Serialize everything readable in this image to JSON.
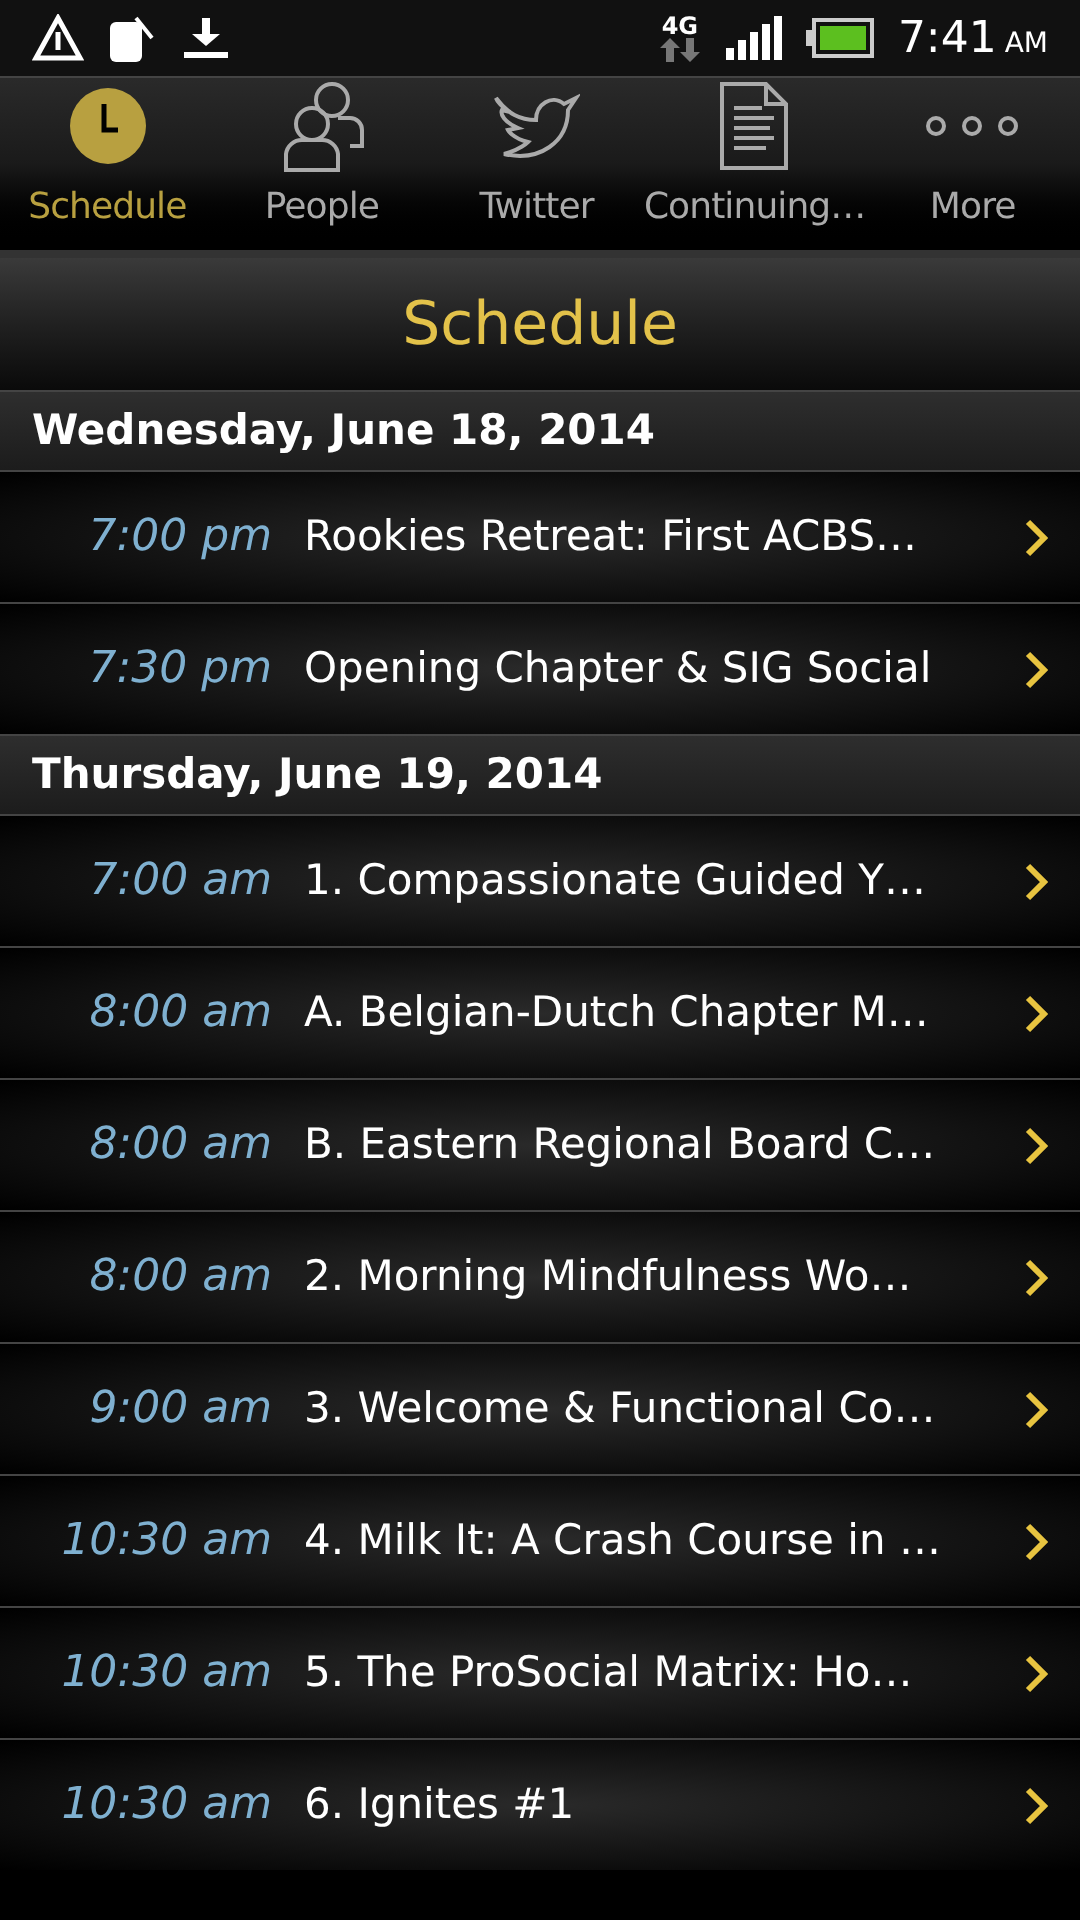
{
  "status_bar": {
    "network": "4G",
    "time": "7:41",
    "ampm": "AM"
  },
  "tabs": [
    {
      "label": "Schedule",
      "kind": "clock",
      "selected": true
    },
    {
      "label": "People",
      "kind": "people",
      "selected": false
    },
    {
      "label": "Twitter",
      "kind": "bird",
      "selected": false
    },
    {
      "label": "Continuing…",
      "kind": "document",
      "selected": false
    },
    {
      "label": "More",
      "kind": "dots",
      "selected": false
    }
  ],
  "title": "Schedule",
  "days": [
    {
      "date": "Wednesday, June 18, 2014",
      "events": [
        {
          "time": "7:00 pm",
          "title": "Rookies Retreat: First ACBS…"
        },
        {
          "time": "7:30 pm",
          "title": "Opening Chapter & SIG Social"
        }
      ]
    },
    {
      "date": "Thursday, June 19, 2014",
      "events": [
        {
          "time": "7:00 am",
          "title": "1. Compassionate Guided Y…"
        },
        {
          "time": "8:00 am",
          "title": "A. Belgian-Dutch Chapter M…"
        },
        {
          "time": "8:00 am",
          "title": "B. Eastern Regional Board C…"
        },
        {
          "time": "8:00 am",
          "title": "2. Morning Mindfulness Wo…"
        },
        {
          "time": "9:00 am",
          "title": "3. Welcome & Functional Co…"
        },
        {
          "time": "10:30 am",
          "title": "4. Milk It: A Crash Course in …"
        },
        {
          "time": "10:30 am",
          "title": "5. The ProSocial Matrix: Ho…"
        },
        {
          "time": "10:30 am",
          "title": "6. Ignites #1"
        }
      ]
    }
  ]
}
